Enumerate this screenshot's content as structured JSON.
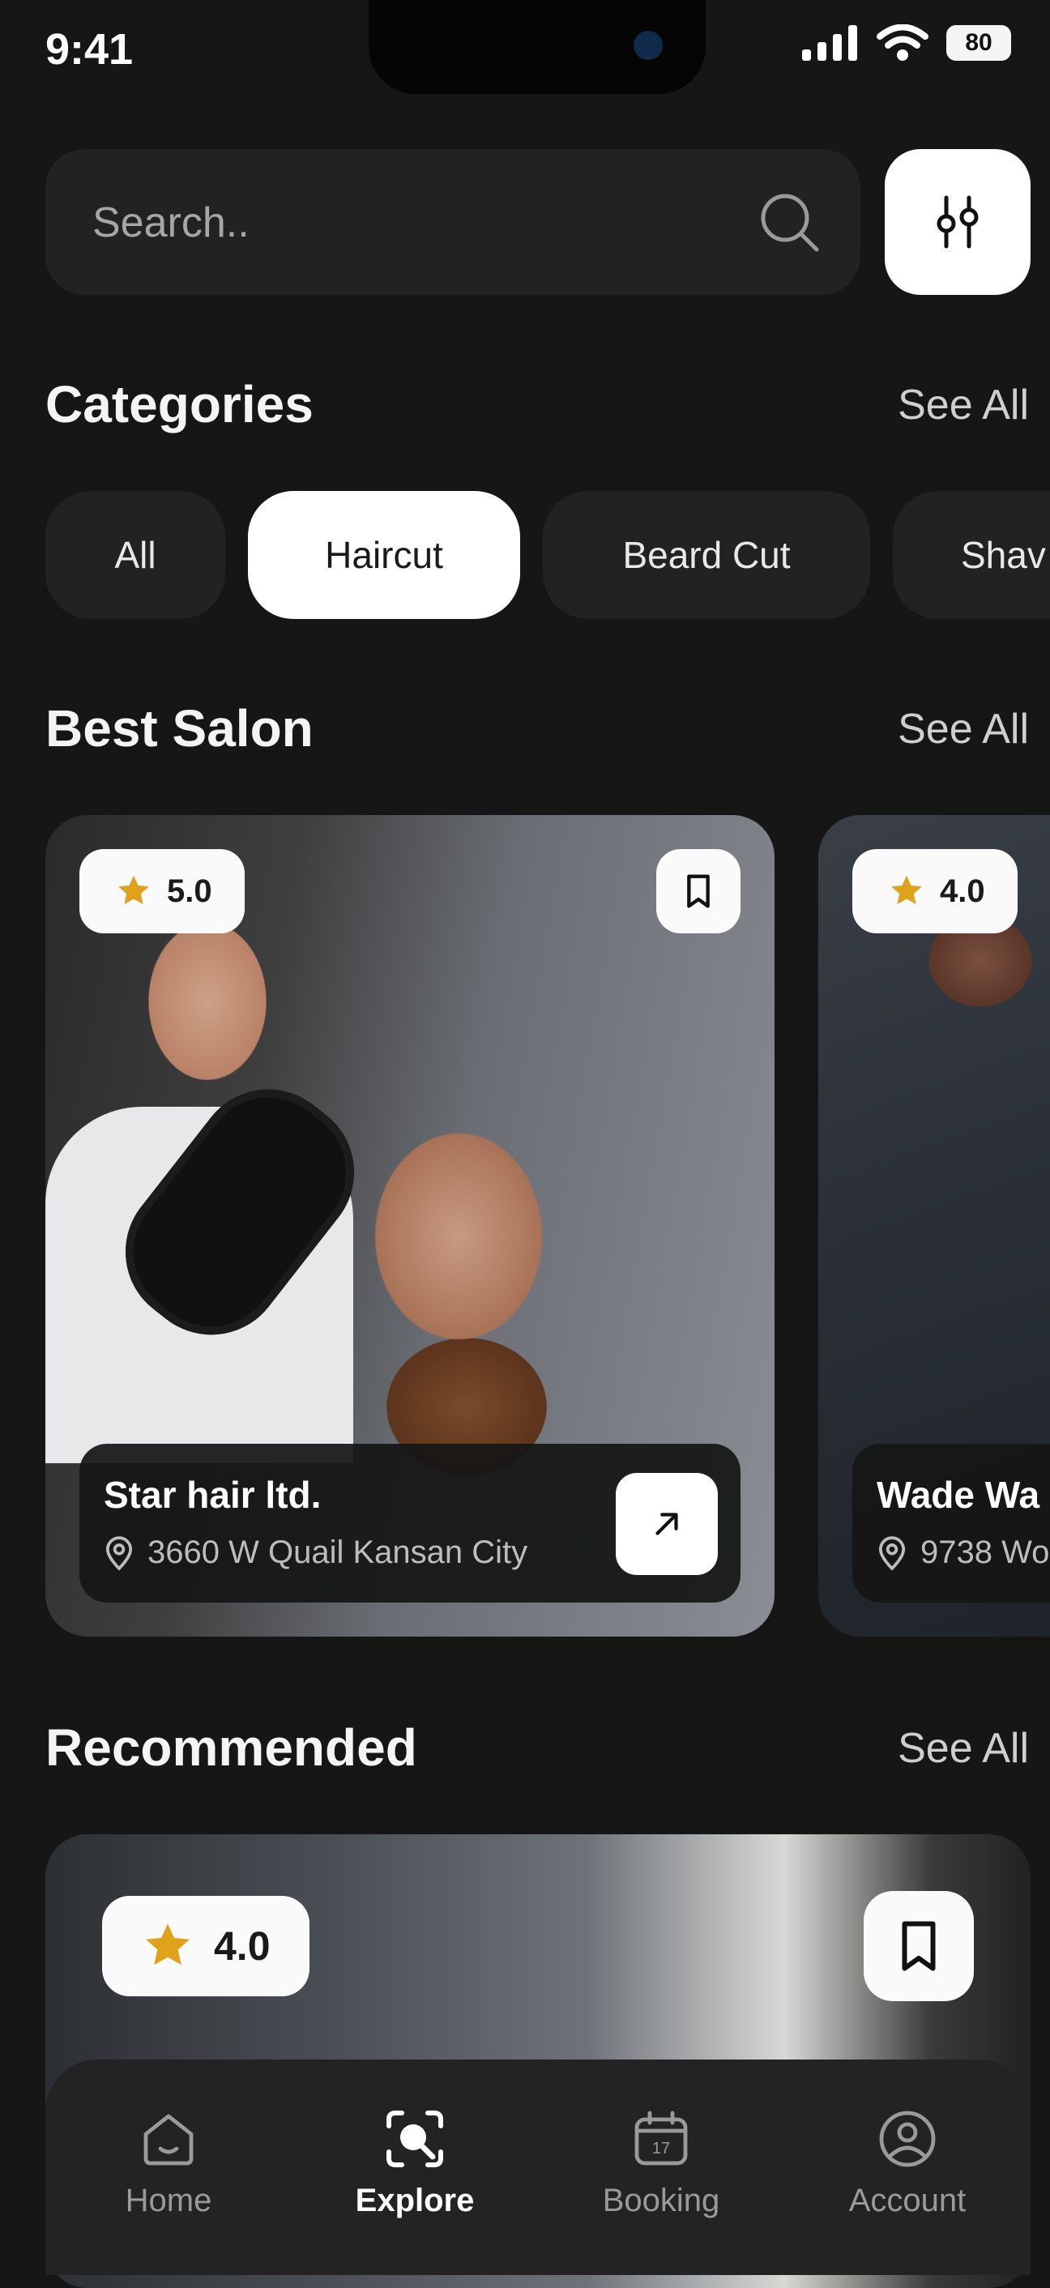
{
  "status_bar": {
    "time": "9:41",
    "battery": "80"
  },
  "search": {
    "placeholder": "Search.."
  },
  "categories": {
    "title": "Categories",
    "see_all": "See All",
    "items": [
      "All",
      "Haircut",
      "Beard Cut",
      "Shav"
    ],
    "selected": "Haircut"
  },
  "best_salon": {
    "title": "Best Salon",
    "see_all": "See All",
    "cards": [
      {
        "rating": "5.0",
        "name": "Star hair ltd.",
        "address": "3660 W Quail Kansan City"
      },
      {
        "rating": "4.0",
        "name": "Wade Wa",
        "address": "9738 Wo"
      }
    ]
  },
  "recommended": {
    "title": "Recommended",
    "see_all": "See All",
    "cards": [
      {
        "rating": "4.0"
      }
    ]
  },
  "bottom_nav": {
    "items": [
      {
        "label": "Home",
        "icon": "home-icon"
      },
      {
        "label": "Explore",
        "icon": "explore-icon"
      },
      {
        "label": "Booking",
        "icon": "calendar-icon"
      },
      {
        "label": "Account",
        "icon": "account-icon"
      }
    ],
    "active": "Explore"
  },
  "colors": {
    "background": "#161616",
    "surface": "#222222",
    "accent": "#ffffff",
    "star": "#e0a11b"
  }
}
